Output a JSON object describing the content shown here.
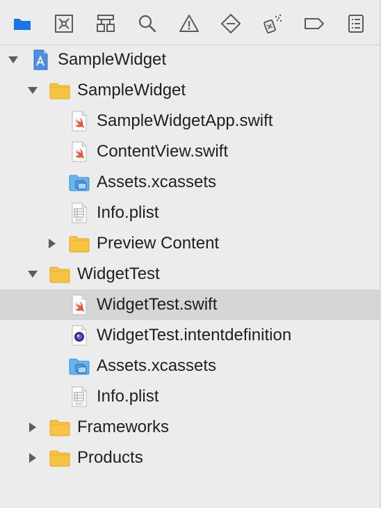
{
  "toolbar": {
    "items": [
      {
        "name": "project-navigator",
        "icon": "folder-icon",
        "active": true
      },
      {
        "name": "source-control-navigator",
        "icon": "source-control-icon"
      },
      {
        "name": "symbol-navigator",
        "icon": "hierarchy-icon"
      },
      {
        "name": "find-navigator",
        "icon": "search-icon"
      },
      {
        "name": "issue-navigator",
        "icon": "warning-icon"
      },
      {
        "name": "test-navigator",
        "icon": "diamond-icon"
      },
      {
        "name": "debug-navigator",
        "icon": "spray-icon"
      },
      {
        "name": "breakpoint-navigator",
        "icon": "tag-icon"
      },
      {
        "name": "report-navigator",
        "icon": "list-icon"
      }
    ],
    "accent": "#1a73e8"
  },
  "tree": {
    "rows": [
      {
        "label": "SampleWidget",
        "type": "project",
        "level": 0,
        "expanded": true
      },
      {
        "label": "SampleWidget",
        "type": "folder",
        "level": 1,
        "expanded": true
      },
      {
        "label": "SampleWidgetApp.swift",
        "type": "swift",
        "level": 2
      },
      {
        "label": "ContentView.swift",
        "type": "swift",
        "level": 2
      },
      {
        "label": "Assets.xcassets",
        "type": "assets",
        "level": 2
      },
      {
        "label": "Info.plist",
        "type": "plist",
        "level": 2
      },
      {
        "label": "Preview Content",
        "type": "folder",
        "level": 2,
        "expanded": false
      },
      {
        "label": "WidgetTest",
        "type": "folder",
        "level": 1,
        "expanded": true
      },
      {
        "label": "WidgetTest.swift",
        "type": "swift",
        "level": 2,
        "selected": true
      },
      {
        "label": "WidgetTest.intentdefinition",
        "type": "intent",
        "level": 2
      },
      {
        "label": "Assets.xcassets",
        "type": "assets",
        "level": 2
      },
      {
        "label": "Info.plist",
        "type": "plist",
        "level": 2
      },
      {
        "label": "Frameworks",
        "type": "folder",
        "level": 1,
        "expanded": false
      },
      {
        "label": "Products",
        "type": "folder",
        "level": 1,
        "expanded": false
      }
    ]
  },
  "icons": {
    "plist_badge": "PLIST"
  }
}
